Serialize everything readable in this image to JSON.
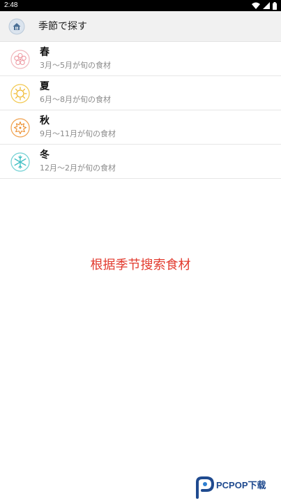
{
  "status_bar": {
    "time": "2:48",
    "icons": [
      "wifi-icon",
      "signal-icon",
      "battery-icon"
    ]
  },
  "app_bar": {
    "icon": "house-icon",
    "title": "季節で探す"
  },
  "seasons": [
    {
      "name": "春",
      "desc": "3月〜5月が旬の食材",
      "icon": "cherry-blossom-icon",
      "color": "#f1b8bd"
    },
    {
      "name": "夏",
      "desc": "6月〜8月が旬の食材",
      "icon": "sun-icon",
      "color": "#f2c84e"
    },
    {
      "name": "秋",
      "desc": "9月〜11月が旬の食材",
      "icon": "maple-leaf-icon",
      "color": "#f0a04b"
    },
    {
      "name": "冬",
      "desc": "12月〜2月が旬の食材",
      "icon": "snowflake-icon",
      "color": "#6fd0d3"
    }
  ],
  "caption": "根据季节搜索食材",
  "watermark": {
    "text": "PCPOP下载"
  },
  "colors": {
    "caption": "#e23a2e",
    "app_bar_bg": "#f1f1f1",
    "watermark": "#1f4a8f"
  }
}
